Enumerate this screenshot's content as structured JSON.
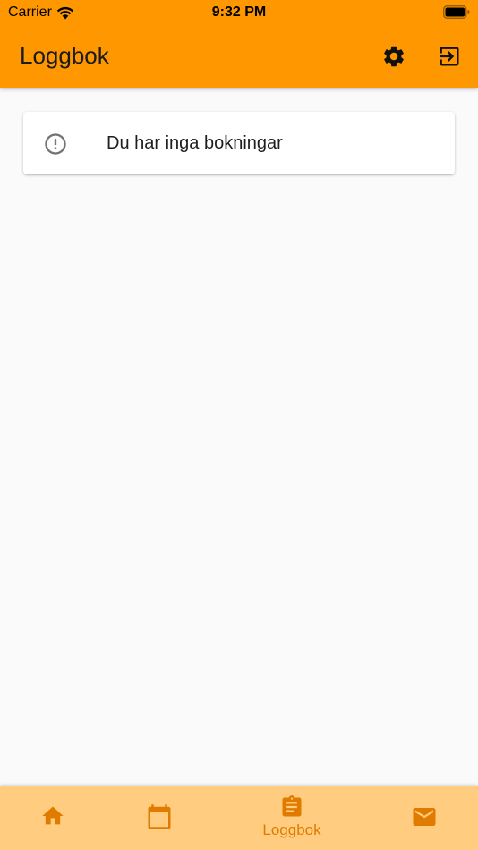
{
  "status_bar": {
    "carrier": "Carrier",
    "time": "9:32 PM"
  },
  "app_bar": {
    "title": "Loggbok",
    "actions": [
      {
        "icon": "gear-icon"
      },
      {
        "icon": "logout-icon"
      }
    ],
    "background_color": "#ff9800"
  },
  "empty_state": {
    "icon": "info-circle-icon",
    "message": "Du har inga bokningar"
  },
  "bottom_nav": {
    "background_color": "#ffcc80",
    "accent_color": "#e07b00",
    "items": [
      {
        "icon": "home-icon",
        "label": ""
      },
      {
        "icon": "calendar-icon",
        "label": ""
      },
      {
        "icon": "clipboard-icon",
        "label": "Loggbok",
        "selected": true
      },
      {
        "icon": "mail-icon",
        "label": ""
      }
    ]
  }
}
